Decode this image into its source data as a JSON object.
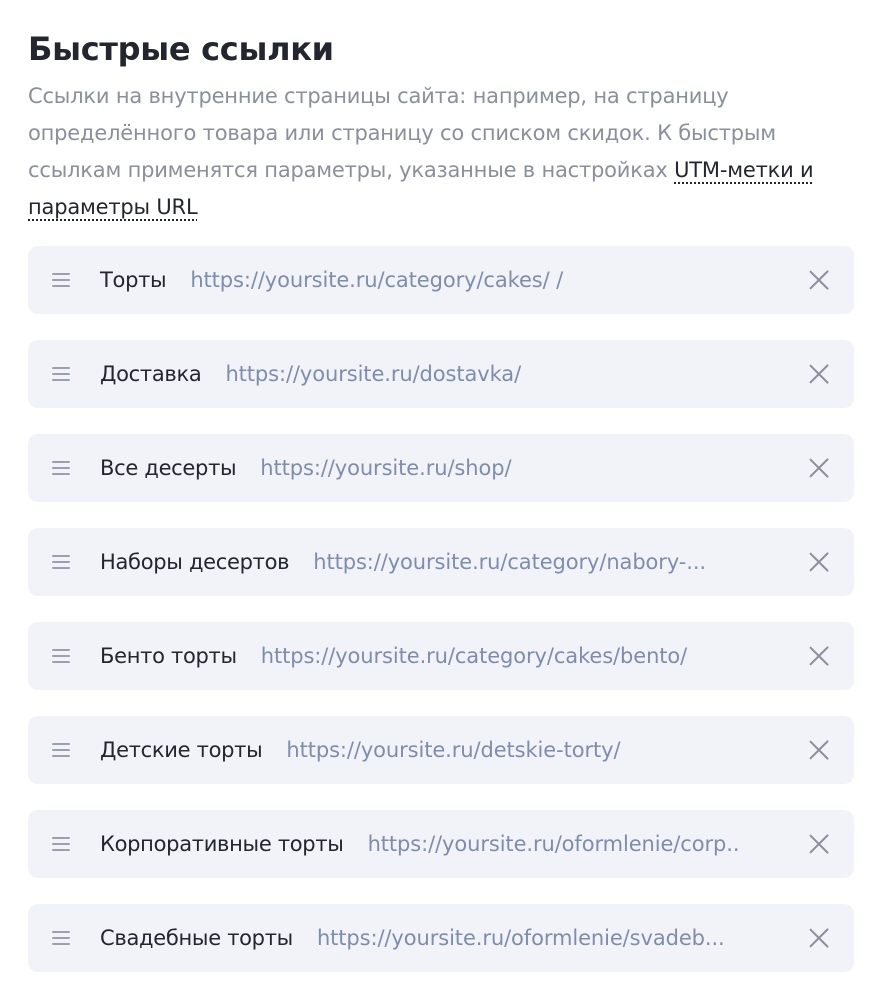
{
  "section": {
    "title": "Быстрые ссылки",
    "description_text": "Ссылки на внутренние страницы сайта: например, на страницу определённого товара или страницу со списком скидок. К быстрым ссылкам применятся параметры, указанные в настройках ",
    "description_link": "UTM-метки и параметры URL"
  },
  "links": [
    {
      "name": "Торты",
      "url": "https://yoursite.ru/category/cakes/  /"
    },
    {
      "name": "Доставка",
      "url": "https://yoursite.ru/dostavka/"
    },
    {
      "name": "Все десерты",
      "url": "https://yoursite.ru/shop/"
    },
    {
      "name": "Наборы десертов",
      "url": "https://yoursite.ru/category/nabory-..."
    },
    {
      "name": "Бенто торты",
      "url": "https://yoursite.ru/category/cakes/bento/"
    },
    {
      "name": "Детские торты",
      "url": "https://yoursite.ru/detskie-torty/"
    },
    {
      "name": "Корпоративные торты",
      "url": "https://yoursite.ru/oformlenie/corp.."
    },
    {
      "name": "Свадебные торты",
      "url": "https://yoursite.ru/oformlenie/svadeb..."
    }
  ],
  "icons": {
    "drag": "drag-handle-icon",
    "remove": "close-icon"
  },
  "colors": {
    "title": "#23262f",
    "description": "#8a8f9c",
    "item_background": "#f1f3f8",
    "url": "#7f8dad",
    "icon": "#8a8f9c"
  }
}
